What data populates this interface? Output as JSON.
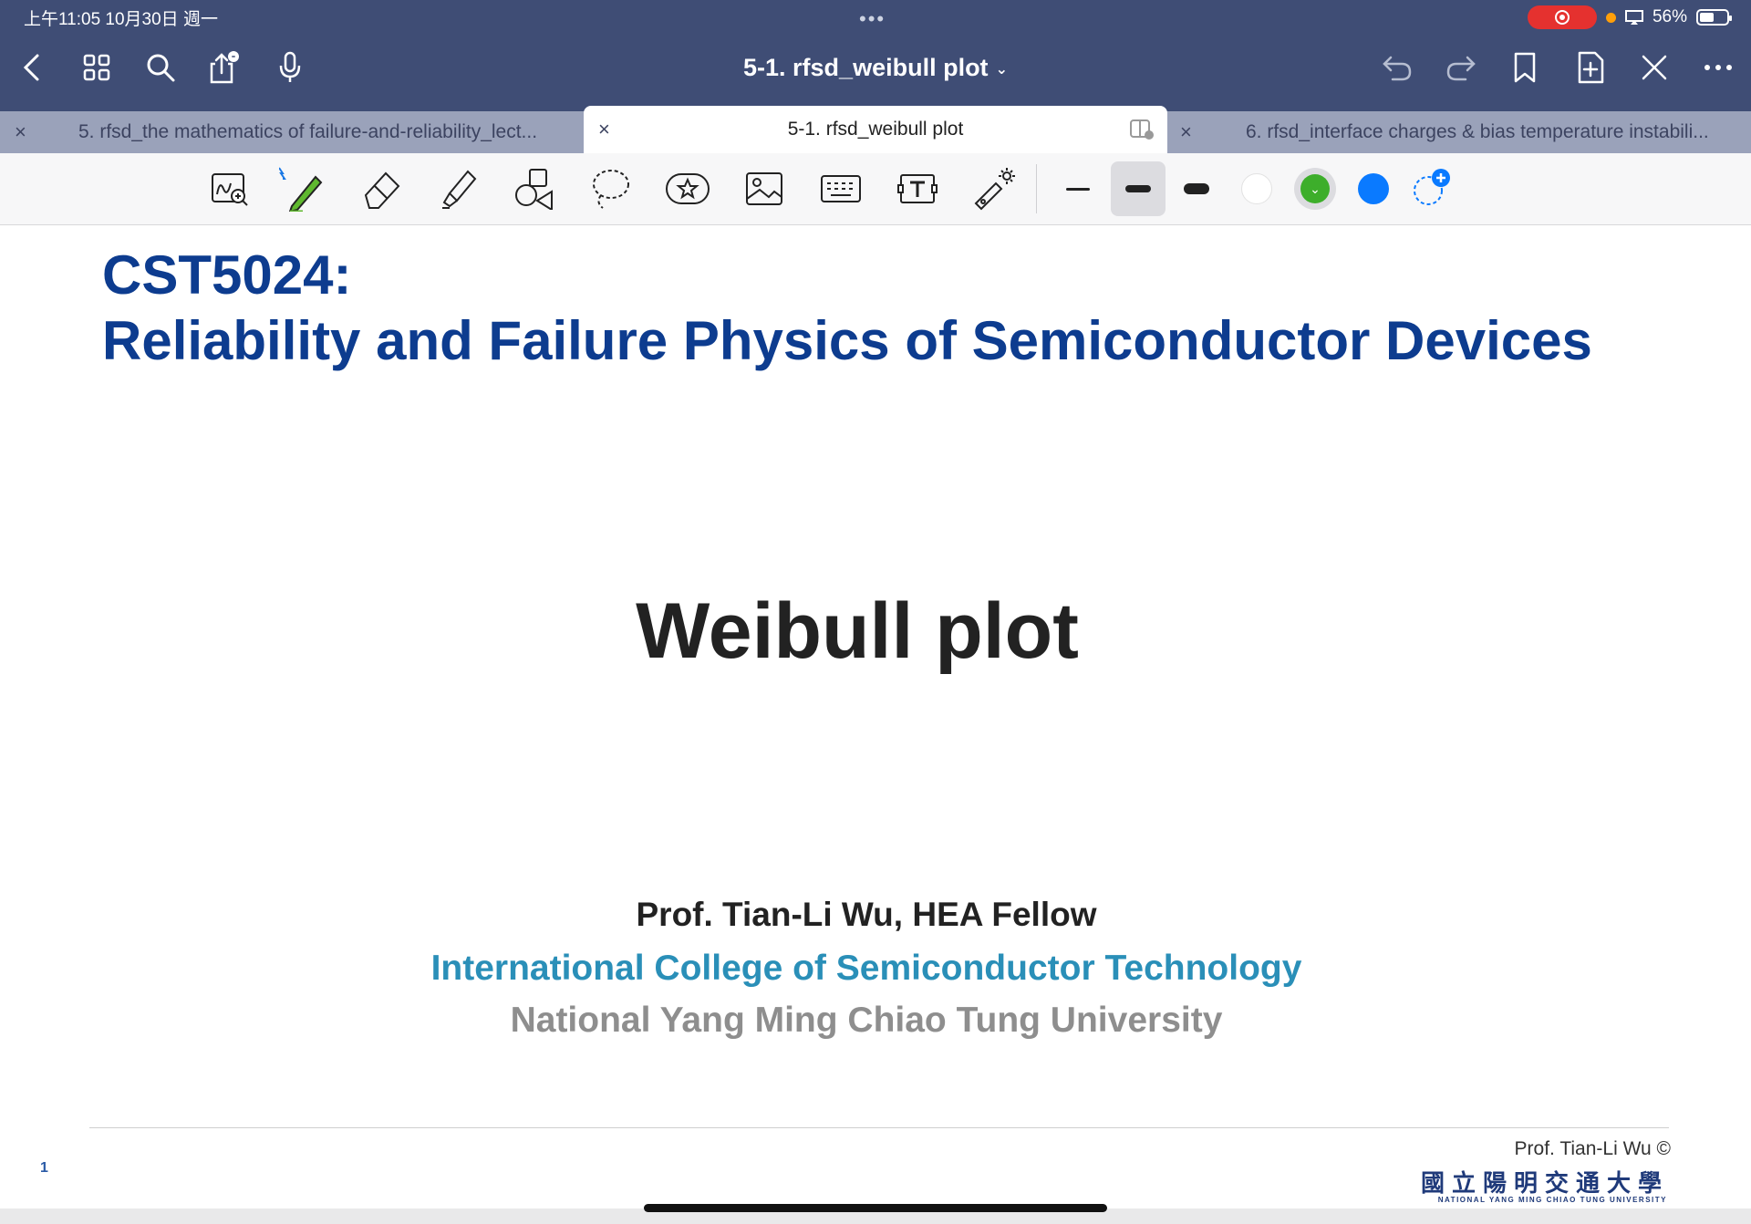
{
  "status_bar": {
    "time_date": "上午11:05   10月30日 週一",
    "battery": "56%",
    "more_dots": "•••"
  },
  "header": {
    "doc_title": "5-1. rfsd_weibull plot",
    "title_chevron": "⌄"
  },
  "tabs": [
    {
      "label": "5. rfsd_the mathematics of failure-and-reliability_lect...",
      "close": "×"
    },
    {
      "label": "5-1. rfsd_weibull plot",
      "close": "×"
    },
    {
      "label": "6. rfsd_interface charges & bias temperature instabili...",
      "close": "×"
    }
  ],
  "toolbar": {
    "tools": [
      "zoom-window-icon",
      "pen-icon",
      "eraser-icon",
      "highlighter-icon",
      "shapes-icon",
      "lasso-icon",
      "sticker-icon",
      "image-icon",
      "keyboard-icon",
      "textbox-icon",
      "laser-pointer-icon"
    ],
    "thickness": [
      "thin",
      "medium",
      "thick"
    ],
    "selected_thickness": "medium",
    "colors": [
      "#ffffff",
      "#3dae2b",
      "#0a7aff"
    ],
    "selected_color": "#3dae2b"
  },
  "slide": {
    "course": "CST5024:",
    "course_title": "Reliability and Failure Physics of Semiconductor Devices",
    "main_title": "Weibull plot",
    "professor": "Prof. Tian-Li Wu, HEA Fellow",
    "college": "International College of Semiconductor Technology",
    "university": "National Yang Ming Chiao Tung University",
    "page_number": "1",
    "credit": "Prof. Tian-Li Wu ©",
    "logo_zh": "國立陽明交通大學",
    "logo_en": "NATIONAL YANG MING CHIAO TUNG UNIVERSITY"
  },
  "colors": {
    "topbar": "#3f4d75",
    "title_blue": "#0d3c8f",
    "college_teal": "#2a8fb8",
    "univ_gray": "#8e8e8e"
  }
}
